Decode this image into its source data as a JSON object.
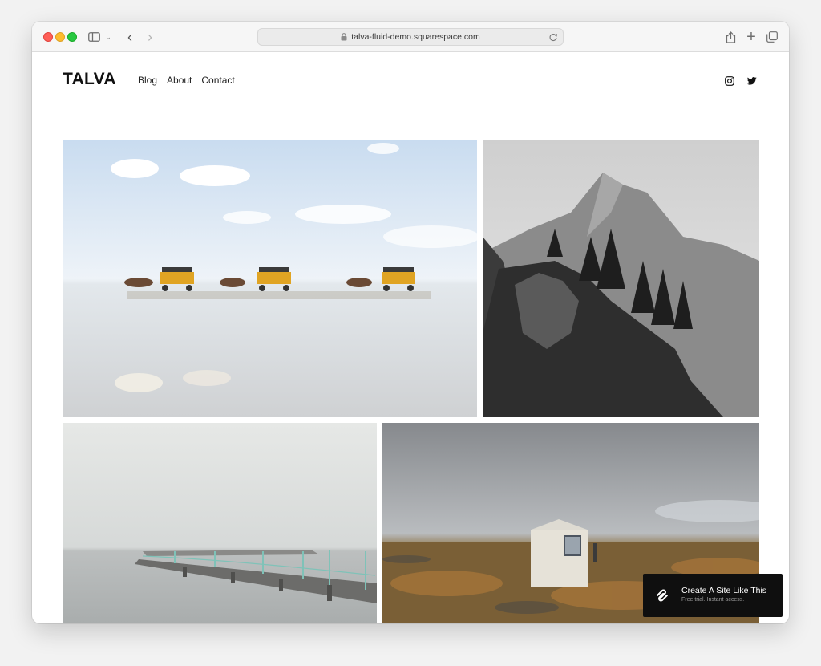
{
  "browser": {
    "url": "talva-fluid-demo.squarespace.com",
    "icons": [
      "sidebar-icon",
      "chevron-down-icon",
      "back-icon",
      "forward-icon",
      "lock-icon",
      "reload-icon",
      "share-icon",
      "plus-icon",
      "tabs-icon"
    ],
    "back_glyph": "‹",
    "forward_glyph": "›",
    "chevron_glyph": "⌄",
    "newtab_glyph": "+"
  },
  "site": {
    "logo": "TALVA",
    "nav": [
      {
        "label": "Blog"
      },
      {
        "label": "About"
      },
      {
        "label": "Contact"
      }
    ],
    "social": [
      "instagram-icon",
      "twitter-icon"
    ]
  },
  "gallery": {
    "images": [
      "horse-carriages-on-tidal-flats",
      "black-and-white-mountain-cliff",
      "misty-pier",
      "white-hut-on-tundra"
    ]
  },
  "cta": {
    "title": "Create A Site Like This",
    "subtitle": "Free trial. Instant access."
  },
  "colors": {
    "traffic_red": "#ff5f57",
    "traffic_yellow": "#febc2e",
    "traffic_green": "#28c840",
    "cta_bg": "#0f0f0f"
  }
}
